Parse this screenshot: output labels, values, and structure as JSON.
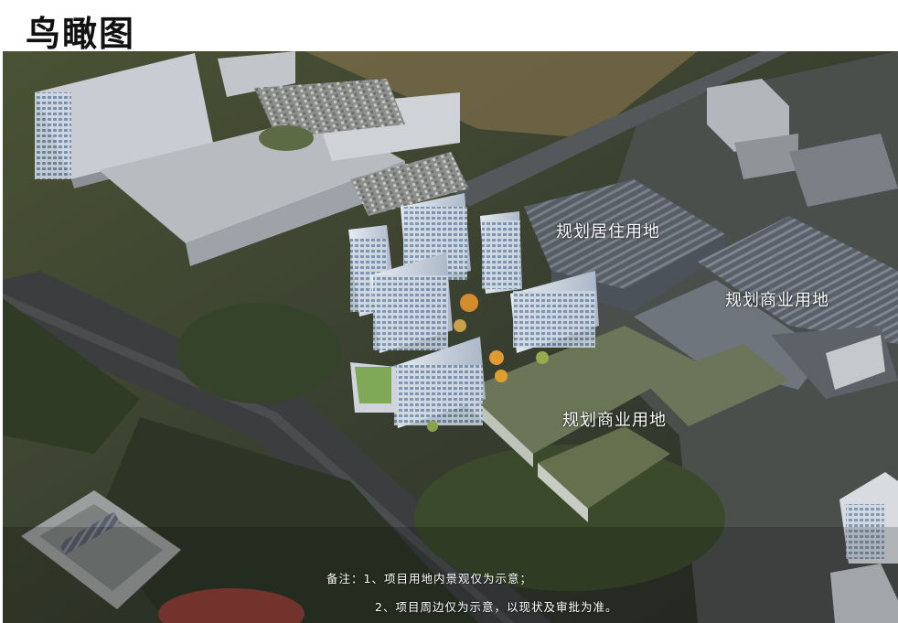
{
  "page": {
    "title": "鸟瞰图"
  },
  "labels": {
    "residential": "规划居住用地",
    "commercial_1": "规划商业用地",
    "commercial_2": "规划商业用地"
  },
  "notes": {
    "line1": "备注：1、项目用地内景观仅为示意；",
    "line2": "2、项目周边仅为示意，以现状及审批为准。"
  }
}
